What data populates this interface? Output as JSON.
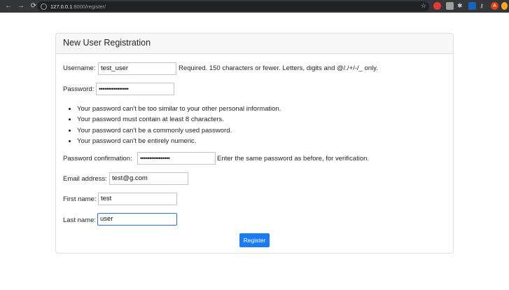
{
  "browser": {
    "url_host": "127.0.0.1",
    "url_path": ":8000/register/"
  },
  "form": {
    "title": "New User Registration",
    "username": {
      "label": "Username:",
      "value": "test_user",
      "help": "Required. 150 characters or fewer. Letters, digits and @/./+/-/_ only."
    },
    "password": {
      "label": "Password:",
      "value": "••••••••••••••••"
    },
    "password_rules": [
      "Your password can't be too similar to your other personal information.",
      "Your password must contain at least 8 characters.",
      "Your password can't be a commonly used password.",
      "Your password can't be entirely numeric."
    ],
    "password_confirmation": {
      "label": "Password confirmation:",
      "value": "••••••••••••••••",
      "help": "Enter the same password as before, for verification."
    },
    "email": {
      "label": "Email address:",
      "value": "test@g.com"
    },
    "first_name": {
      "label": "First name:",
      "value": "test"
    },
    "last_name": {
      "label": "Last name:",
      "value": "user"
    },
    "submit_label": "Register"
  },
  "colors": {
    "accent": "#1a7cf5",
    "focus_border": "#2a6fd6"
  }
}
